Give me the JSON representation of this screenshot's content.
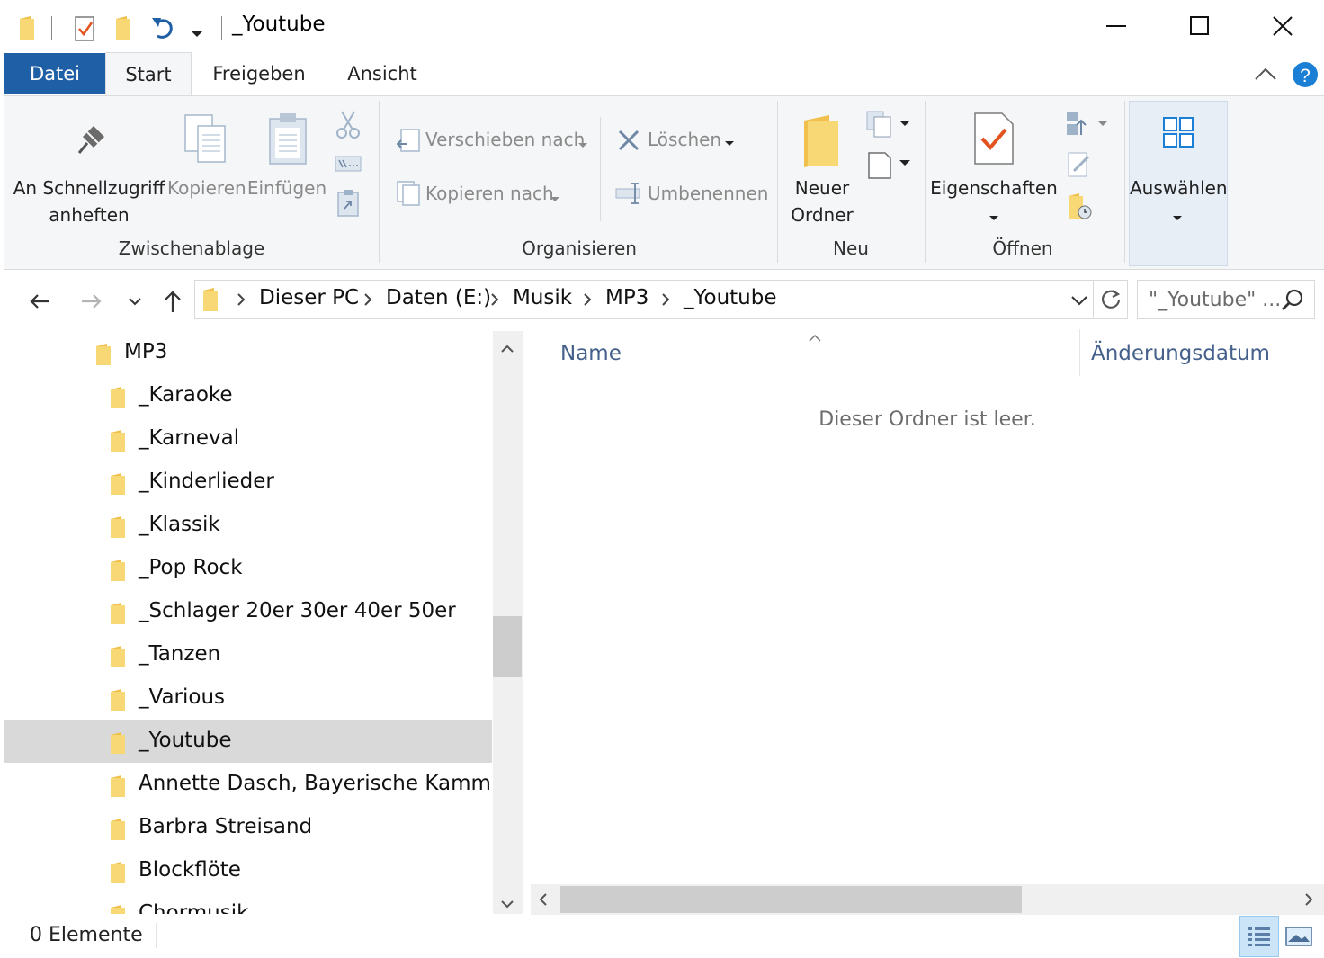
{
  "window": {
    "title": "_Youtube"
  },
  "ribbon_tabs": [
    "Datei",
    "Start",
    "Freigeben",
    "Ansicht"
  ],
  "ribbon": {
    "pin_label_1": "An Schnellzugriff",
    "pin_label_2": "anheften",
    "copy": "Kopieren",
    "paste": "Einfügen",
    "move_to": "Verschieben nach",
    "copy_to": "Kopieren nach",
    "delete": "Löschen",
    "rename": "Umbenennen",
    "new_folder_1": "Neuer",
    "new_folder_2": "Ordner",
    "properties": "Eigenschaften",
    "select": "Auswählen",
    "groups": {
      "clipboard": "Zwischenablage",
      "organize": "Organisieren",
      "new": "Neu",
      "open": "Öffnen"
    }
  },
  "address": {
    "crumbs": [
      "Dieser PC",
      "Daten (E:)",
      "Musik",
      "MP3",
      "_Youtube"
    ],
    "search_placeholder": "\"_Youtube\" ..."
  },
  "nav_tree": {
    "parent": "MP3",
    "children": [
      "_Karaoke",
      "_Karneval",
      "_Kinderlieder",
      "_Klassik",
      "_Pop Rock",
      "_Schlager 20er 30er 40er 50er",
      "_Tanzen",
      "_Various",
      "_Youtube",
      "Annette Dasch, Bayerische Kammerp",
      "Barbra Streisand",
      "Blockflöte",
      "Chormusik"
    ],
    "selected": "_Youtube"
  },
  "content": {
    "columns": [
      "Name",
      "Änderungsdatum"
    ],
    "empty_message": "Dieser Ordner ist leer."
  },
  "status_bar": {
    "item_count": "0 Elemente"
  },
  "colors": {
    "accent": "#1f5fa6",
    "folder": "#f8d775",
    "help": "#1c7fd6"
  }
}
